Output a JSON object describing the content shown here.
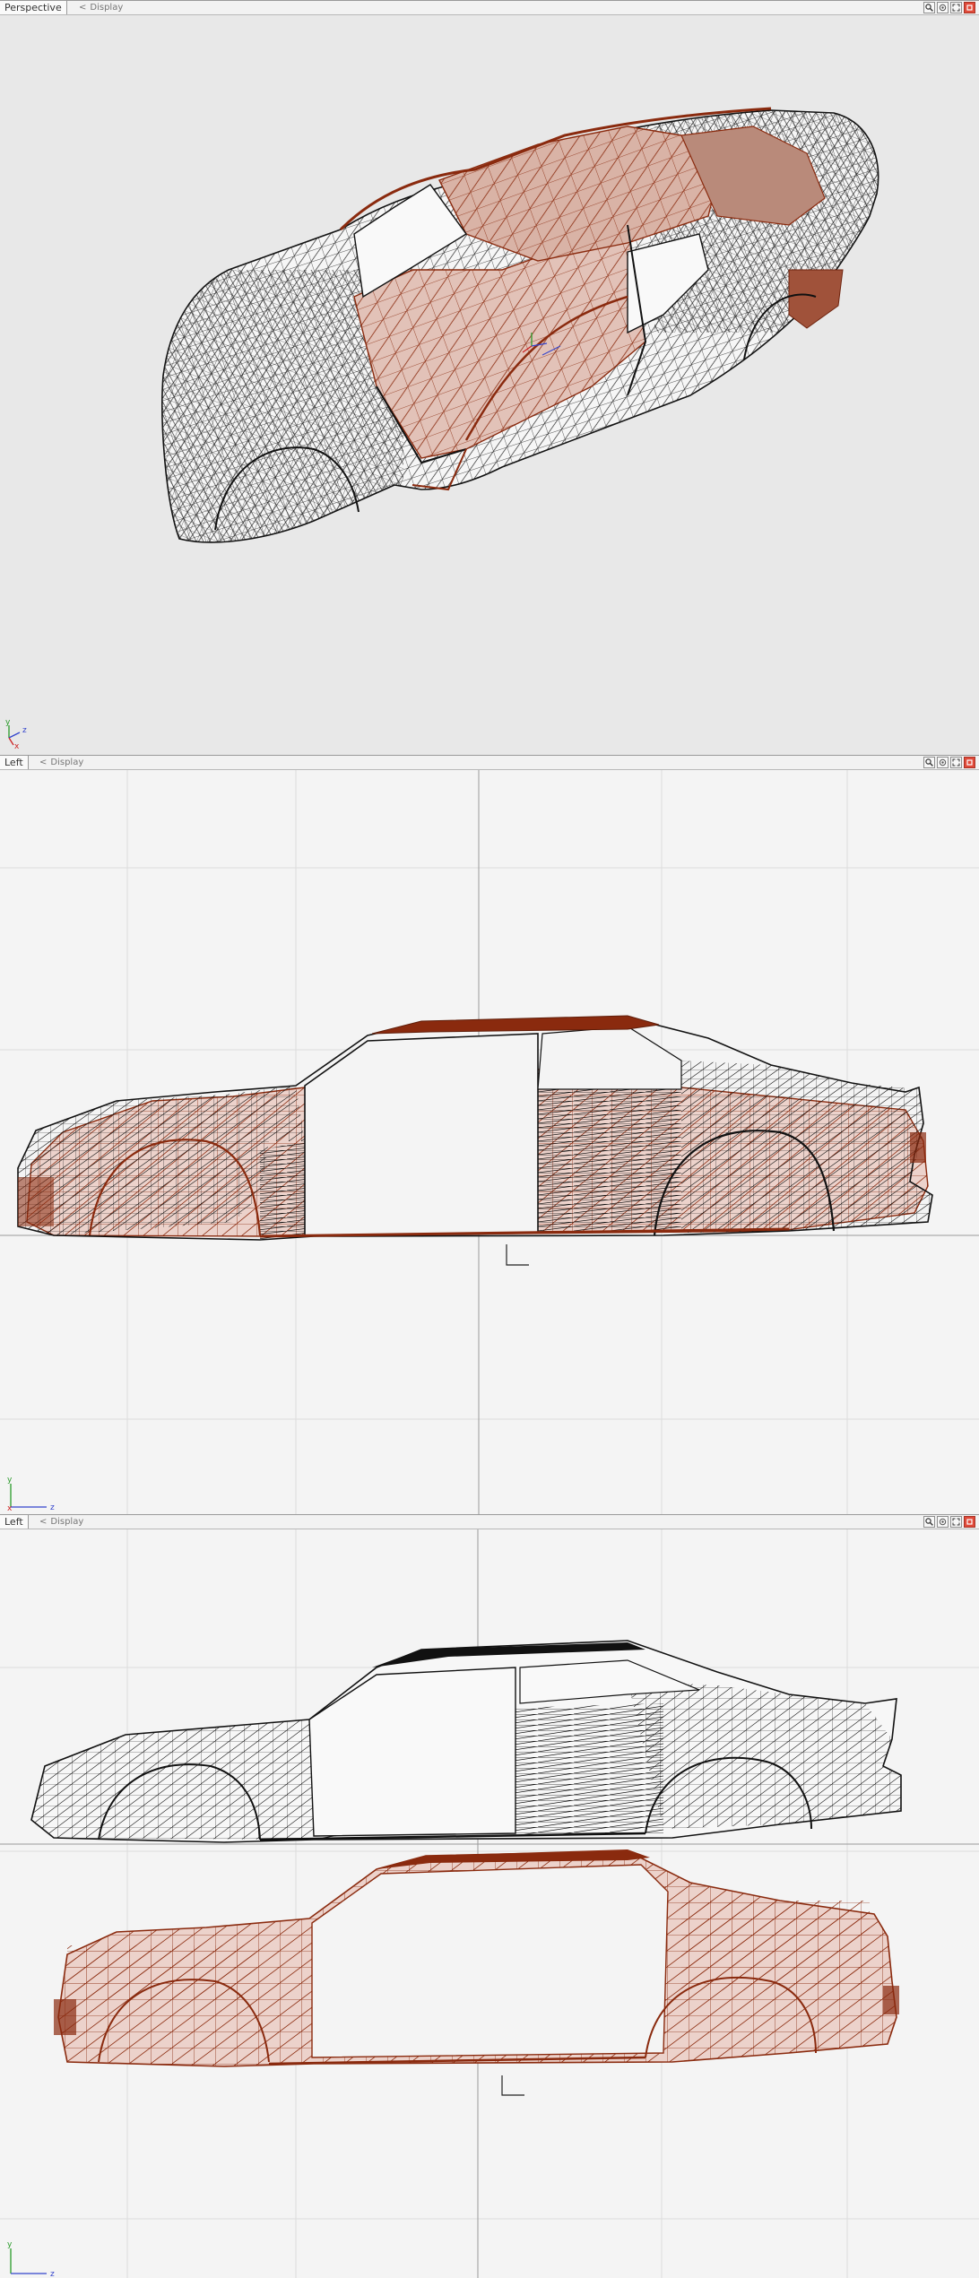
{
  "viewports": [
    {
      "title": "Perspective",
      "menu": "Display"
    },
    {
      "title": "Left",
      "menu": "Display"
    },
    {
      "title": "Left",
      "menu": "Display"
    }
  ],
  "toolbar_icons": [
    "zoom-icon",
    "rotate-view-icon",
    "maximize-icon",
    "close-viewport-icon"
  ],
  "axes": {
    "x": "x",
    "y": "y",
    "z": "z"
  },
  "colors": {
    "wire_black": "#111111",
    "wire_rust": "#8a2a0e",
    "fill_rust": "#e6c4bb",
    "close_red": "#e04a3a"
  }
}
